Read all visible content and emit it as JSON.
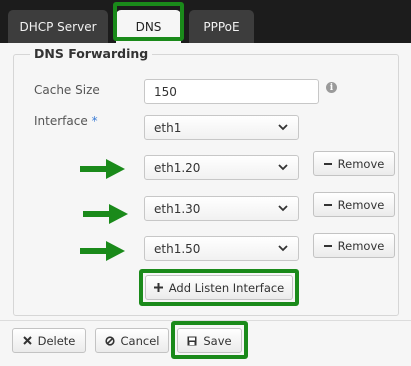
{
  "tabs": [
    {
      "label": "DHCP Server",
      "active": false
    },
    {
      "label": "DNS",
      "active": true
    },
    {
      "label": "PPPoE",
      "active": false
    }
  ],
  "section": {
    "title": "DNS Forwarding"
  },
  "cache_size": {
    "label": "Cache Size",
    "value": "150"
  },
  "interface": {
    "label": "Interface",
    "required_marker": "*"
  },
  "interfaces": [
    {
      "value": "eth1"
    },
    {
      "value": "eth1.20",
      "remove_label": "Remove"
    },
    {
      "value": "eth1.30",
      "remove_label": "Remove"
    },
    {
      "value": "eth1.50",
      "remove_label": "Remove"
    }
  ],
  "add_listen_interface": {
    "label": "Add Listen Interface"
  },
  "footer": {
    "delete_label": "Delete",
    "cancel_label": "Cancel",
    "save_label": "Save"
  },
  "colors": {
    "highlight": "#1a8a1a",
    "arrow": "#1a8a1a",
    "tab_active_bg": "#f6f6f6",
    "tab_inactive_bg": "#3d3d3d",
    "required": "#3a7bd5"
  },
  "icons": {
    "info": "info-icon",
    "chevron": "chevron-down-icon",
    "remove": "minus-icon",
    "add": "plus-icon",
    "delete": "x-icon",
    "cancel": "ban-icon",
    "save": "save-icon"
  }
}
